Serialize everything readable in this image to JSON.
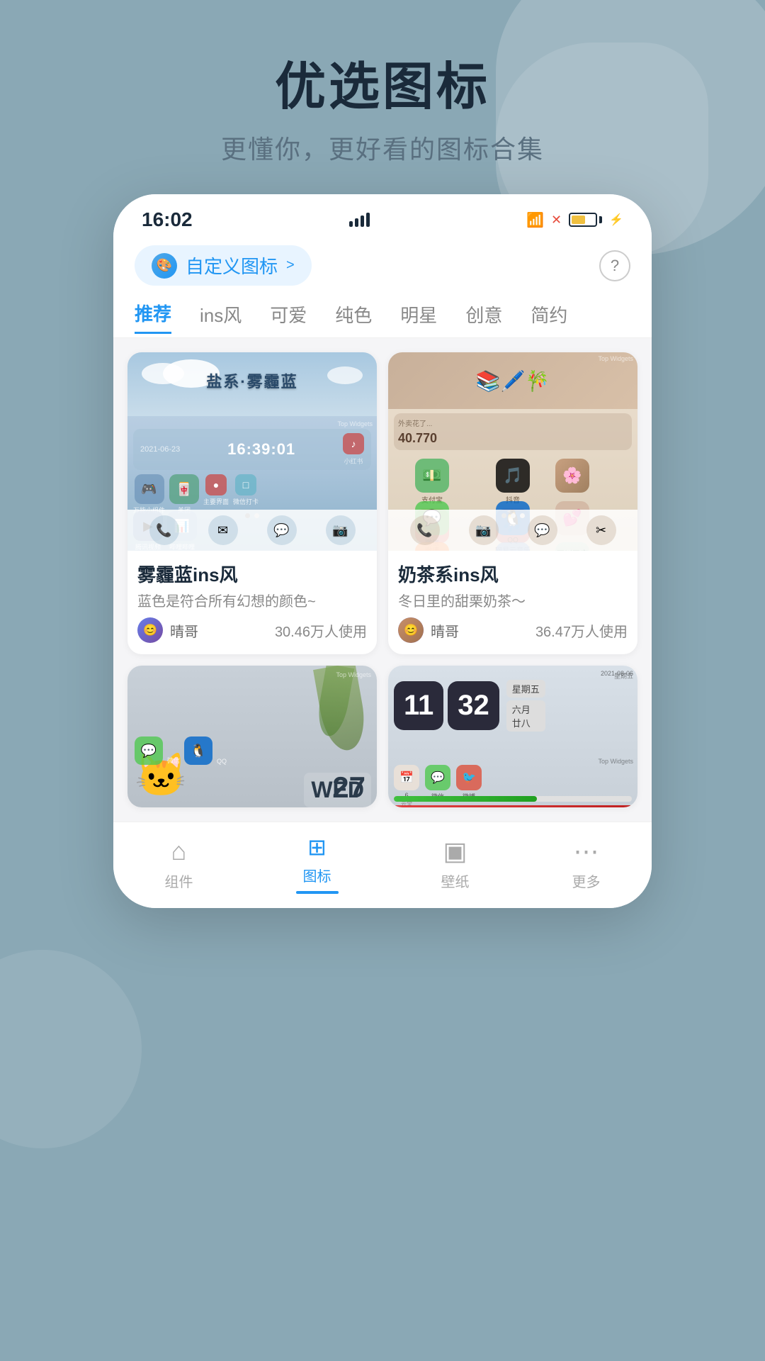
{
  "background_color": "#8aa8b5",
  "header": {
    "title": "优选图标",
    "subtitle": "更懂你，更好看的图标合集"
  },
  "status_bar": {
    "time": "16:02",
    "signal_label": "signal",
    "wifi_label": "wifi",
    "battery_level": 60
  },
  "custom_bar": {
    "button_text": "自定义图标",
    "button_arrow": ">",
    "help_label": "?"
  },
  "tabs": [
    {
      "label": "推荐",
      "active": true
    },
    {
      "label": "ins风",
      "active": false
    },
    {
      "label": "可爱",
      "active": false
    },
    {
      "label": "纯色",
      "active": false
    },
    {
      "label": "明星",
      "active": false
    },
    {
      "label": "创意",
      "active": false
    },
    {
      "label": "简约",
      "active": false
    }
  ],
  "theme_cards": [
    {
      "name": "雾霾蓝ins风",
      "desc": "蓝色是符合所有幻想的颜色~",
      "author": "晴哥",
      "users": "30.46万人使用",
      "preview_type": "blue",
      "preview_title": "盐系·雾霾蓝",
      "has_crown": true
    },
    {
      "name": "奶茶系ins风",
      "desc": "冬日里的甜栗奶茶～",
      "author": "晴哥",
      "users": "36.47万人使用",
      "preview_type": "cream",
      "preview_title": "",
      "has_crown": false
    },
    {
      "name": "",
      "desc": "",
      "author": "",
      "users": "",
      "preview_type": "cat",
      "preview_title": "",
      "has_crown": false
    },
    {
      "name": "",
      "desc": "",
      "author": "",
      "users": "",
      "preview_type": "dark",
      "preview_title": "",
      "has_crown": false
    }
  ],
  "bottom_tabs": [
    {
      "label": "组件",
      "icon": "⌂",
      "active": false
    },
    {
      "label": "图标",
      "icon": "⊞",
      "active": true
    },
    {
      "label": "壁纸",
      "icon": "▣",
      "active": false
    },
    {
      "label": "更多",
      "icon": "⋯",
      "active": false
    }
  ]
}
